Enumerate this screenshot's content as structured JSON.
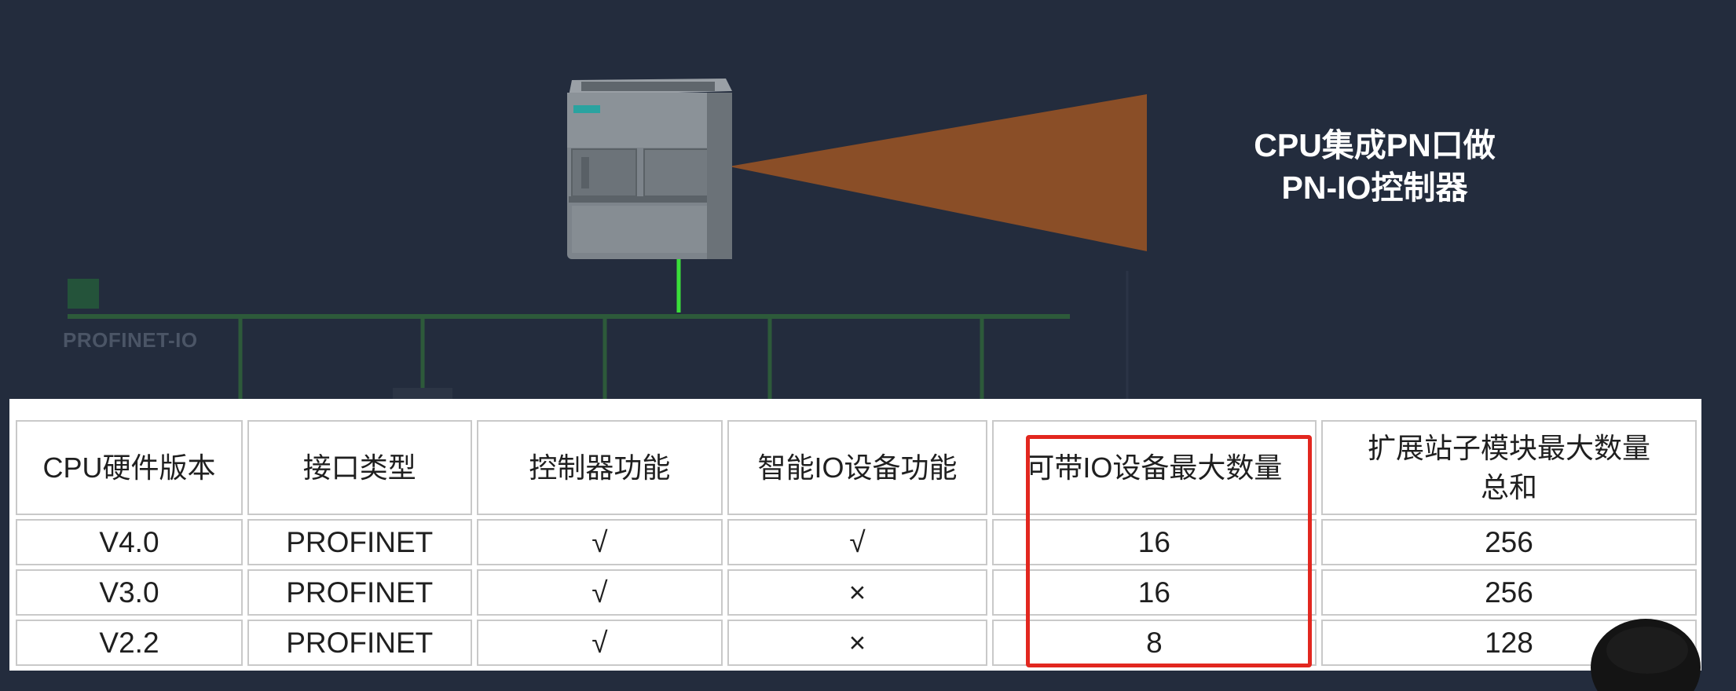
{
  "callout": {
    "line1": "CPU集成PN口做",
    "line2": "PN-IO控制器"
  },
  "network": {
    "label": "PROFINET-IO",
    "bus_color": "#2d5a3a",
    "link_color": "#3adf3a"
  },
  "device": {
    "brand_icon": "siemens-plc-icon"
  },
  "beam_color": "#8a4e27",
  "highlight_color": "#e2271f",
  "table": {
    "headers": [
      "CPU硬件版本",
      "接口类型",
      "控制器功能",
      "智能IO设备功能",
      "可带IO设备最大数量",
      "扩展站子模块最大数量总和"
    ],
    "header_last_line1": "扩展站子模块最大数量",
    "header_last_line2": "总和",
    "rows": [
      [
        "V4.0",
        "PROFINET",
        "√",
        "√",
        "16",
        "256"
      ],
      [
        "V3.0",
        "PROFINET",
        "√",
        "×",
        "16",
        "256"
      ],
      [
        "V2.2",
        "PROFINET",
        "√",
        "×",
        "8",
        "128"
      ]
    ]
  }
}
